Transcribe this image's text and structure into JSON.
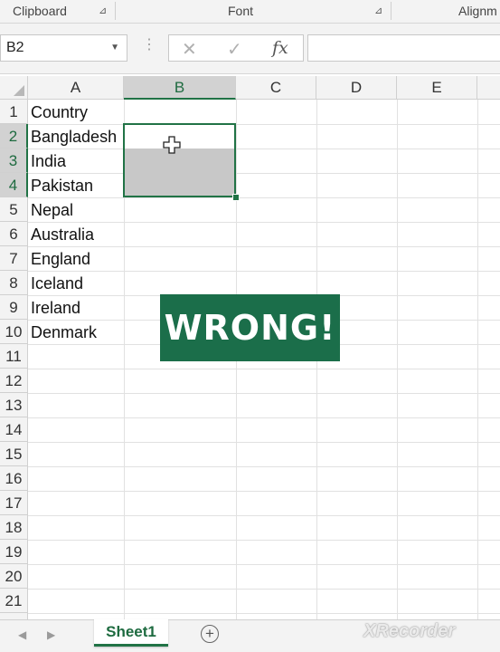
{
  "ribbon": {
    "groups": [
      {
        "label": "Clipboard"
      },
      {
        "label": "Font"
      },
      {
        "label": "Alignm"
      }
    ]
  },
  "formula_bar": {
    "name_box": "B2",
    "cancel_glyph": "✕",
    "enter_glyph": "✓",
    "fx_label": "fx",
    "formula_value": ""
  },
  "sheet": {
    "columns": [
      "A",
      "B",
      "C",
      "D",
      "E"
    ],
    "selected_column": "B",
    "rows": [
      "1",
      "2",
      "3",
      "4",
      "5",
      "6",
      "7",
      "8",
      "9",
      "10",
      "11",
      "12",
      "13",
      "14",
      "15",
      "16",
      "17",
      "18",
      "19",
      "20",
      "21"
    ],
    "selected_rows": [
      "2",
      "3",
      "4"
    ],
    "column_a": [
      "Country",
      "Bangladesh",
      "India",
      "Pakistan",
      "Nepal",
      "Australia",
      "England",
      "Iceland",
      "Ireland",
      "Denmark"
    ]
  },
  "overlay": {
    "text": "WRONG!",
    "background": "#1b6e4a"
  },
  "tabs": {
    "active_sheet": "Sheet1",
    "add_glyph": "+",
    "watermark": "XRecorder"
  },
  "colors": {
    "accent": "#217346",
    "selection_fill": "#c8c8c8"
  }
}
